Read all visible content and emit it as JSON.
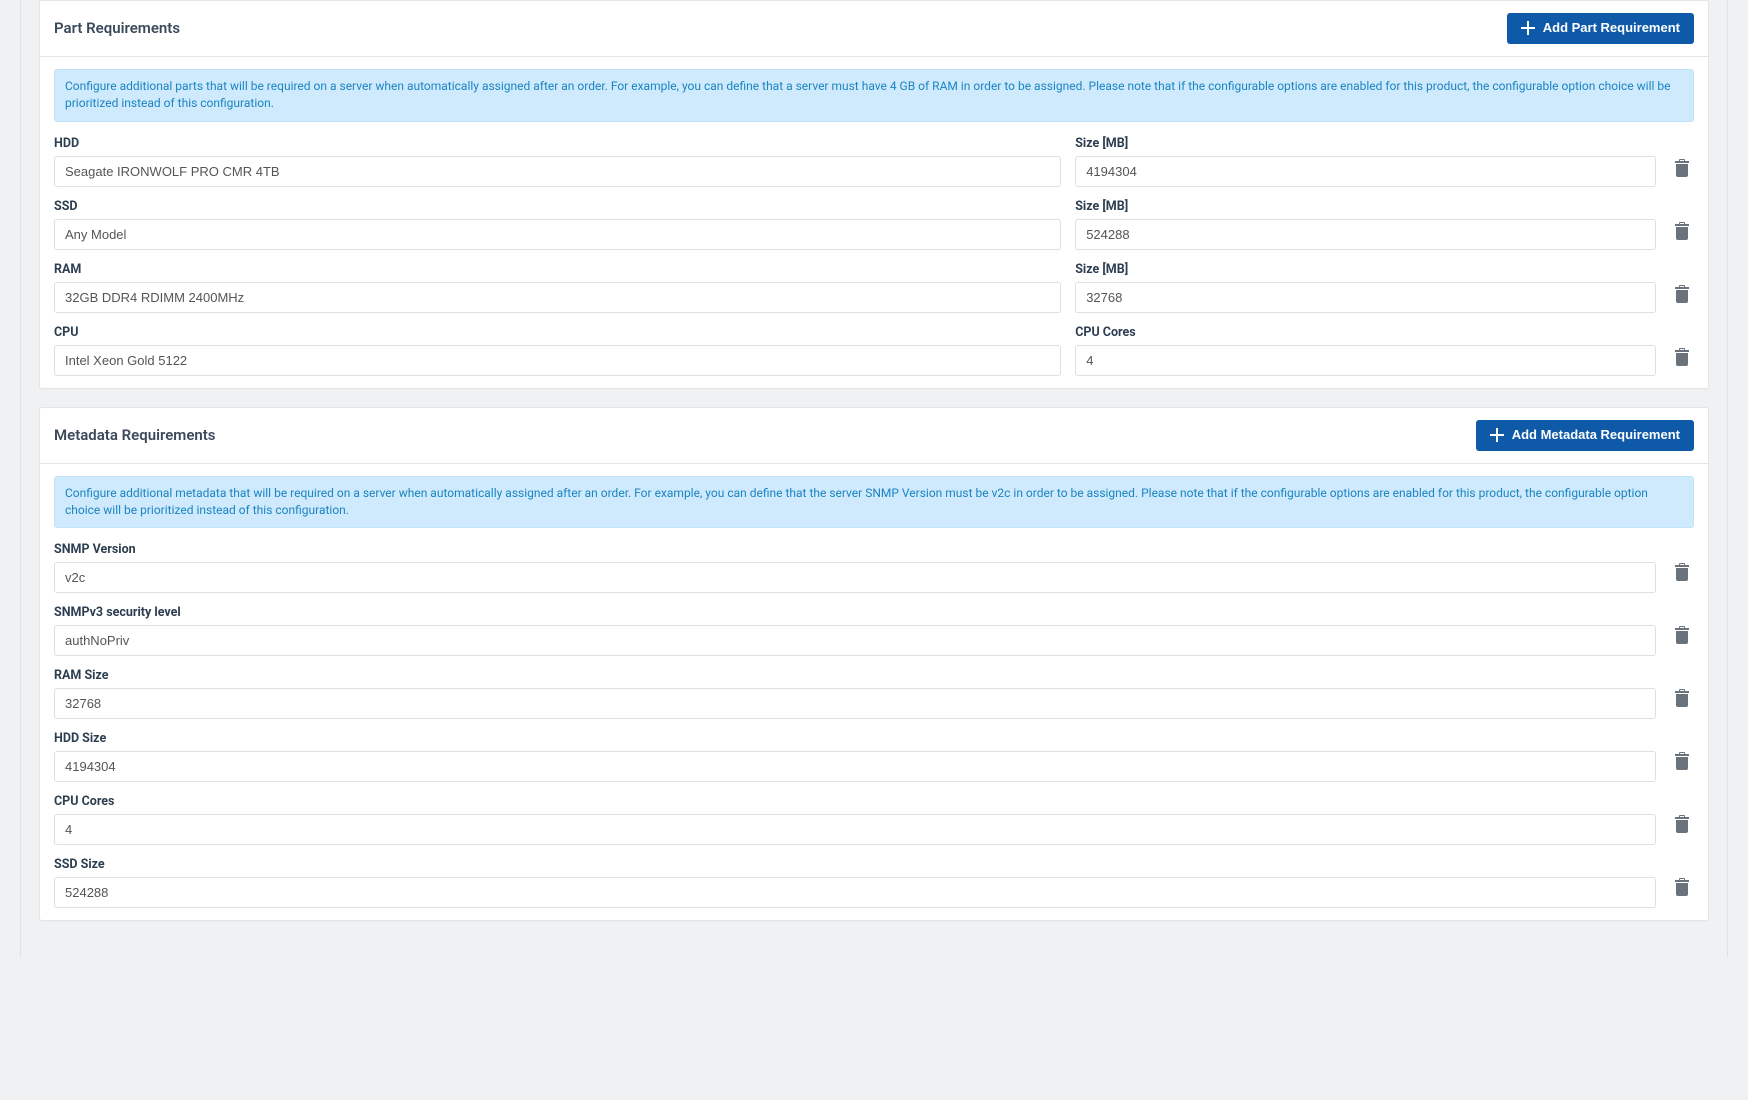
{
  "part_panel": {
    "title": "Part Requirements",
    "add_label": "Add Part Requirement",
    "info_text": "Configure additional parts that will be required on a server when automatically assigned after an order. For example, you can define that a server must have 4 GB of RAM in order to be assigned. ",
    "info_highlight": "Please note that if the configurable options are enabled for this product, the configurable option choice will be prioritized instead of this configuration.",
    "rows": [
      {
        "label1": "HDD",
        "value1": "Seagate IRONWOLF PRO CMR 4TB",
        "label2": "Size [MB]",
        "value2": "4194304"
      },
      {
        "label1": "SSD",
        "value1": "Any Model",
        "label2": "Size [MB]",
        "value2": "524288"
      },
      {
        "label1": "RAM",
        "value1": "32GB DDR4 RDIMM 2400MHz",
        "label2": "Size [MB]",
        "value2": "32768"
      },
      {
        "label1": "CPU",
        "value1": "Intel Xeon Gold 5122",
        "label2": "CPU Cores",
        "value2": "4"
      }
    ]
  },
  "meta_panel": {
    "title": "Metadata Requirements",
    "add_label": "Add Metadata Requirement",
    "info_text": "Configure additional metadata that will be required on a server when automatically assigned after an order. For example, you can define that the server SNMP Version must be v2c in order to be assigned. ",
    "info_highlight": "Please note that if the configurable options are enabled for this product, the configurable option choice will be prioritized instead of this configuration.",
    "rows": [
      {
        "label": "SNMP Version",
        "value": "v2c"
      },
      {
        "label": "SNMPv3 security level",
        "value": "authNoPriv"
      },
      {
        "label": "RAM Size",
        "value": "32768"
      },
      {
        "label": "HDD Size",
        "value": "4194304"
      },
      {
        "label": "CPU Cores",
        "value": "4"
      },
      {
        "label": "SSD Size",
        "value": "524288"
      }
    ]
  }
}
